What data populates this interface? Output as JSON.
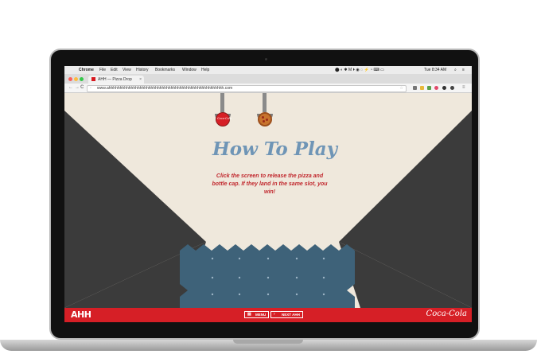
{
  "menubar": {
    "apple": "",
    "app_name": "Chrome",
    "menus": [
      "File",
      "Edit",
      "View",
      "History",
      "Bookmarks",
      "Window",
      "Help"
    ],
    "clock": "Tue 8:34 AM"
  },
  "browser": {
    "tab_title": "AHH — Pizza Drop",
    "tab_close": "×",
    "url": "www.ahhhhhhhhhhhhhhhhhhhhhhhhhhhhhhhhhhhhhhhhhhhhhhhhhhhh.com",
    "back": "←",
    "forward": "→",
    "reload": "C"
  },
  "game": {
    "title": "How To Play",
    "instructions": "Click the screen to release the pizza and bottle cap. If they land in the same slot, you win!",
    "cap_brand": "Coca-Cola"
  },
  "footer": {
    "logo": "AHH",
    "menu_label": "MENU",
    "next_label": "NEXT AHH",
    "brand": "Coca-Cola"
  },
  "colors": {
    "accent_red": "#d61f26",
    "title_blue": "#6f95b6",
    "slot_blue": "#3e6279",
    "dark_wall": "#3b3b3b"
  }
}
